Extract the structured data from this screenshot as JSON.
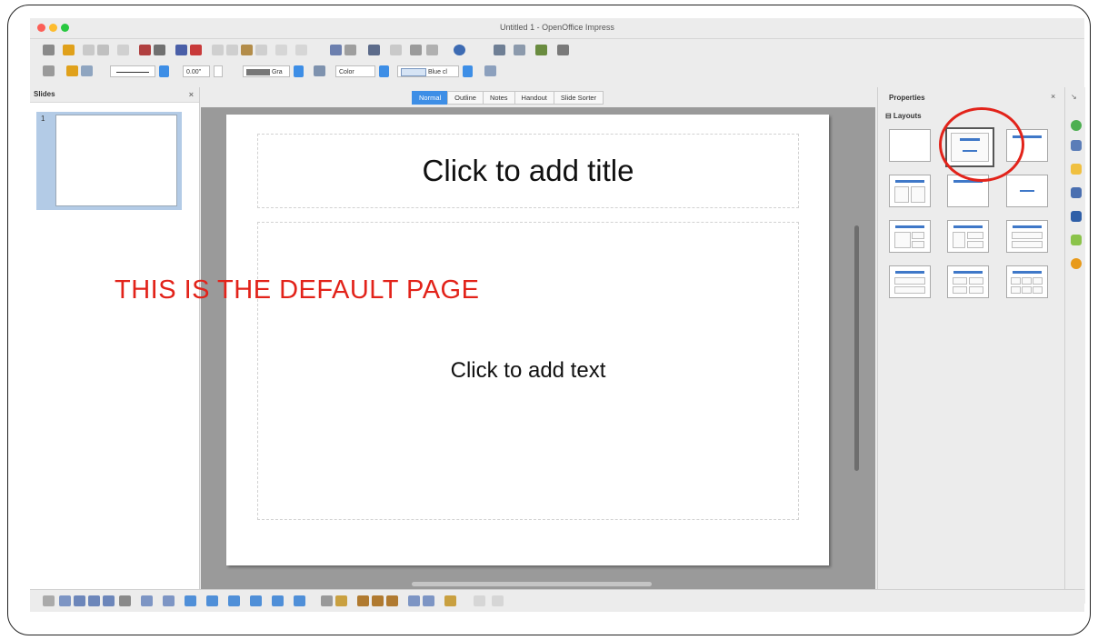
{
  "window": {
    "title": "Untitled 1 - OpenOffice Impress"
  },
  "toolbar_format": {
    "line_width": "0.00\"",
    "line_color_label": "Gra",
    "area_style": "Color",
    "area_color_label": "Blue cl"
  },
  "slides_panel": {
    "title": "Slides",
    "close": "×",
    "thumb_number": "1"
  },
  "view_tabs": [
    "Normal",
    "Outline",
    "Notes",
    "Handout",
    "Slide Sorter"
  ],
  "slide": {
    "title_placeholder": "Click to add title",
    "text_placeholder": "Click to add text"
  },
  "properties_panel": {
    "title": "Properties",
    "close": "×",
    "section": "⊟ Layouts"
  },
  "annotation": {
    "text": "THIS IS THE DEFAULT PAGE",
    "color": "#e2231a"
  },
  "colors": {
    "accent": "#3d8ee6",
    "layout_bar": "#3f78c8",
    "annotation_red": "#e2231a"
  }
}
